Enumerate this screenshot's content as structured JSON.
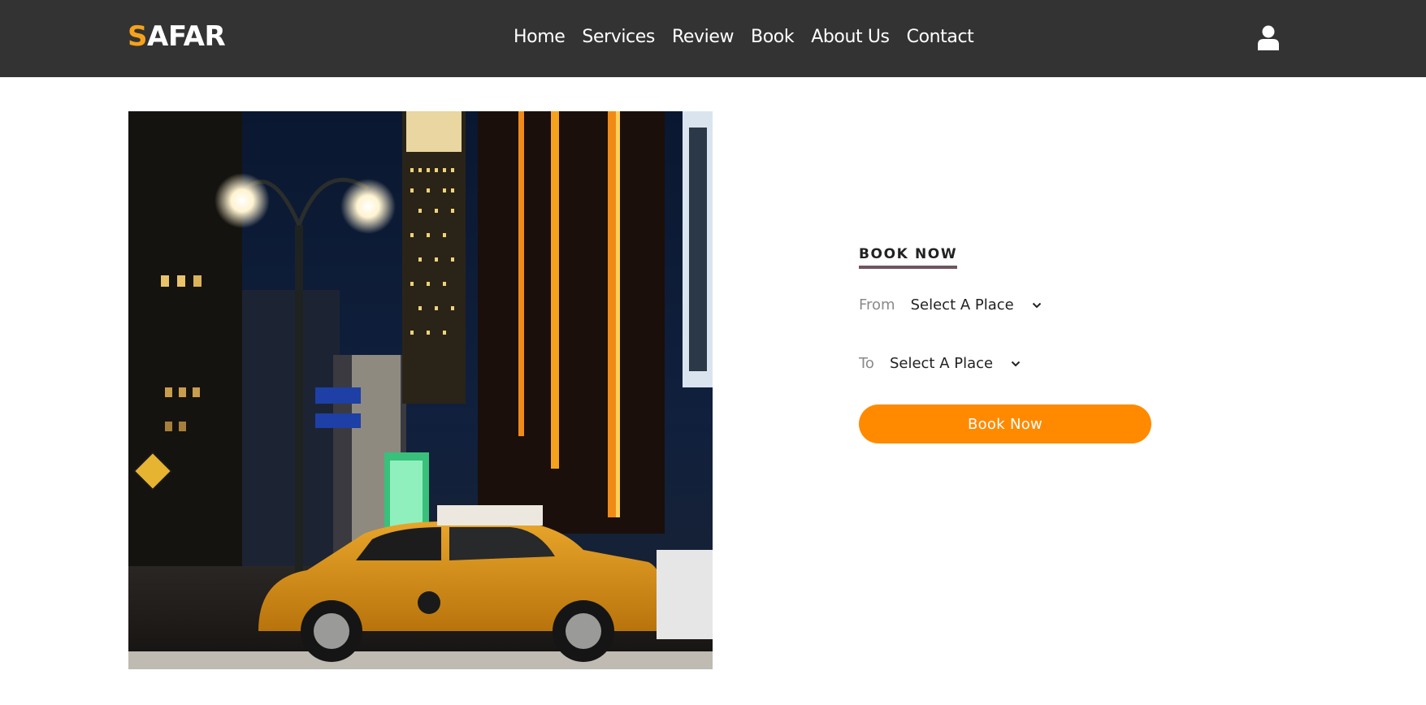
{
  "header": {
    "logo": {
      "first_letter": "S",
      "rest": "AFAR"
    },
    "nav": [
      "Home",
      "Services",
      "Review",
      "Book",
      "About Us",
      "Contact"
    ],
    "user_icon": "user-icon"
  },
  "booking": {
    "heading": "BOOK NOW",
    "from": {
      "label": "From",
      "value": "Select A Place"
    },
    "to": {
      "label": "To",
      "value": "Select A Place"
    },
    "button": "Book Now"
  },
  "colors": {
    "header_bg": "#333333",
    "accent": "#f7a21b",
    "button": "#ff8a00",
    "heading_underline": "#6e5560"
  }
}
